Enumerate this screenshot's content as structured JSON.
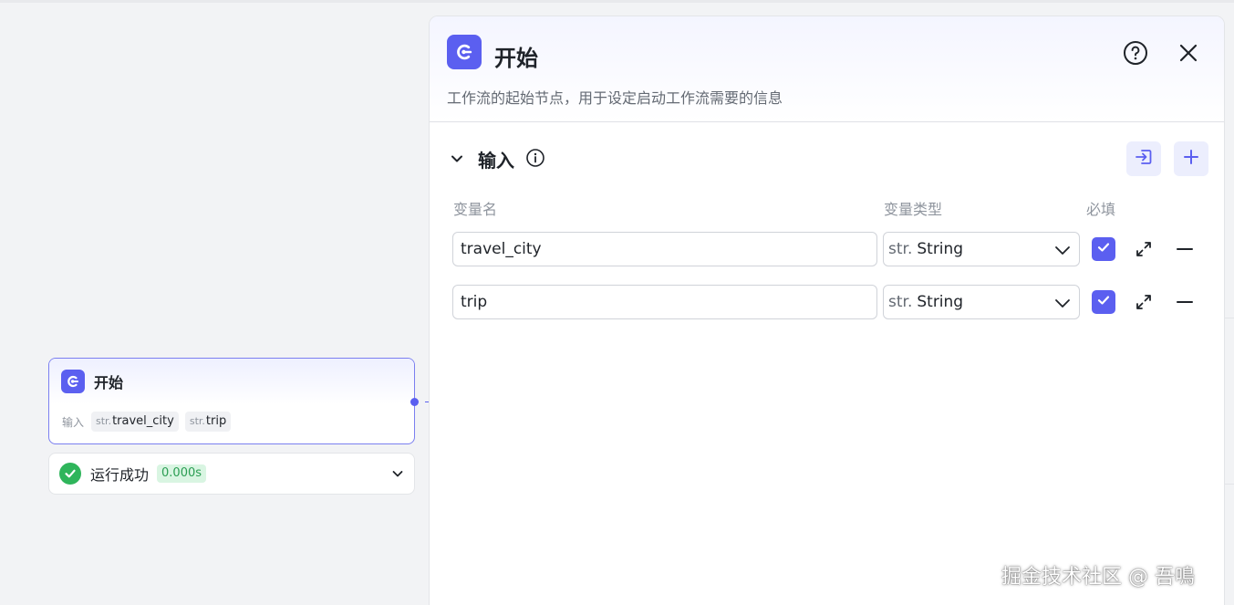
{
  "canvas": {
    "node": {
      "title": "开始",
      "inputs_label": "输入",
      "vars": [
        {
          "type": "str.",
          "name": "travel_city"
        },
        {
          "type": "str.",
          "name": "trip"
        }
      ]
    },
    "run_status": {
      "label": "运行成功",
      "time": "0.000s"
    }
  },
  "panel": {
    "title": "开始",
    "description": "工作流的起始节点，用于设定启动工作流需要的信息",
    "section": {
      "title": "输入",
      "columns": {
        "name": "变量名",
        "type": "变量类型",
        "required": "必填"
      },
      "rows": [
        {
          "name": "travel_city",
          "type_prefix": "str.",
          "type": "String",
          "required": true
        },
        {
          "name": "trip",
          "type_prefix": "str.",
          "type": "String",
          "required": true
        }
      ]
    }
  },
  "watermark": "掘金技术社区 @ 吾鳴",
  "colors": {
    "accent": "#5b5ff0",
    "success": "#2fb55b"
  },
  "icons": [
    "workflow-start-icon",
    "help-icon",
    "close-icon",
    "chevron-down-icon",
    "info-icon",
    "import-icon",
    "plus-icon",
    "check-icon",
    "expand-icon",
    "minus-icon"
  ]
}
